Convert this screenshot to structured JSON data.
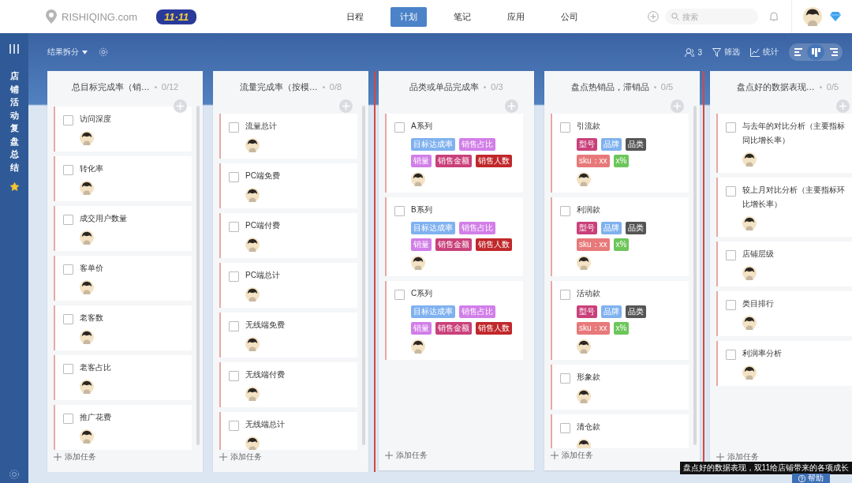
{
  "header": {
    "logo_text": "RISHIQING.com",
    "badge": "11·11",
    "nav": [
      {
        "label": "日程",
        "selected": false
      },
      {
        "label": "计划",
        "selected": true
      },
      {
        "label": "笔记",
        "selected": false
      },
      {
        "label": "应用",
        "selected": false
      },
      {
        "label": "公司",
        "selected": false
      }
    ],
    "search": {
      "placeholder": "搜索"
    }
  },
  "sidebar": {
    "title": "店铺活动复盘总结"
  },
  "toolbar": {
    "view": "结果拆分",
    "members": "3",
    "filter": "筛选",
    "stats": "统计",
    "views": [
      {
        "kind": "left",
        "selected": false
      },
      {
        "kind": "board",
        "selected": true
      },
      {
        "kind": "right",
        "selected": false
      }
    ]
  },
  "columns": [
    {
      "title": "总目标完成率（销…",
      "count": "0/12",
      "highlighted": false,
      "scrollable": true,
      "scrolled_to_end": true,
      "add_label": "添加任务",
      "cards": [
        {
          "title": "访问深度",
          "checked": false
        },
        {
          "title": "转化率",
          "checked": false
        },
        {
          "title": "成交用户数量",
          "checked": false
        },
        {
          "title": "客单价",
          "checked": false
        },
        {
          "title": "老客数",
          "checked": false
        },
        {
          "title": "老客占比",
          "checked": false
        },
        {
          "title": "推广花费",
          "checked": false
        }
      ]
    },
    {
      "title": "流量完成率（按模…",
      "count": "0/8",
      "highlighted": false,
      "scrollable": true,
      "scrolled_to_end": false,
      "add_label": "添加任务",
      "cards": [
        {
          "title": "流量总计",
          "checked": false
        },
        {
          "title": "PC端免费",
          "checked": false
        },
        {
          "title": "PC端付费",
          "checked": false
        },
        {
          "title": "PC端总计",
          "checked": false
        },
        {
          "title": "无线端免费",
          "checked": false
        },
        {
          "title": "无线端付费",
          "checked": false
        },
        {
          "title": "无线端总计",
          "checked": false
        }
      ]
    },
    {
      "title": "品类或单品完成率",
      "count": "0/3",
      "highlighted": true,
      "scrollable": false,
      "scrolled_to_end": false,
      "add_label": "添加任务",
      "cards": [
        {
          "title": "A系列",
          "checked": false,
          "tags": [
            {
              "label": "目标达成率",
              "color": "#7fb1ef"
            },
            {
              "label": "销售占比",
              "color": "#d27ee8"
            },
            {
              "label": "销量",
              "color": "#d27ee8"
            },
            {
              "label": "销售金额",
              "color": "#c9407a"
            },
            {
              "label": "销售人数",
              "color": "#c0282b"
            }
          ]
        },
        {
          "title": "B系列",
          "checked": false,
          "tags": [
            {
              "label": "目标达成率",
              "color": "#7fb1ef"
            },
            {
              "label": "销售占比",
              "color": "#d27ee8"
            },
            {
              "label": "销量",
              "color": "#d27ee8"
            },
            {
              "label": "销售金额",
              "color": "#c9407a"
            },
            {
              "label": "销售人数",
              "color": "#c0282b"
            }
          ]
        },
        {
          "title": "C系列",
          "checked": false,
          "tags": [
            {
              "label": "目标达成率",
              "color": "#7fb1ef"
            },
            {
              "label": "销售占比",
              "color": "#d27ee8"
            },
            {
              "label": "销量",
              "color": "#d27ee8"
            },
            {
              "label": "销售金额",
              "color": "#c9407a"
            },
            {
              "label": "销售人数",
              "color": "#c0282b"
            }
          ]
        }
      ]
    },
    {
      "title": "盘点热销品，滞销品",
      "count": "0/5",
      "highlighted": true,
      "scrollable": true,
      "scrolled_to_end": false,
      "add_label": "添加任务",
      "cards": [
        {
          "title": "引流款",
          "checked": false,
          "tags": [
            {
              "label": "型号",
              "color": "#c9407a"
            },
            {
              "label": "品牌",
              "color": "#7fb1ef"
            },
            {
              "label": "品类",
              "color": "#555555"
            },
            {
              "label": "sku：xx",
              "color": "#e8797a"
            },
            {
              "label": "x%",
              "color": "#6cc65a"
            }
          ]
        },
        {
          "title": "利润款",
          "checked": false,
          "tags": [
            {
              "label": "型号",
              "color": "#c9407a"
            },
            {
              "label": "品牌",
              "color": "#7fb1ef"
            },
            {
              "label": "品类",
              "color": "#555555"
            },
            {
              "label": "sku：xx",
              "color": "#e8797a"
            },
            {
              "label": "x%",
              "color": "#6cc65a"
            }
          ]
        },
        {
          "title": "活动款",
          "checked": false,
          "tags": [
            {
              "label": "型号",
              "color": "#c9407a"
            },
            {
              "label": "品牌",
              "color": "#7fb1ef"
            },
            {
              "label": "品类",
              "color": "#555555"
            },
            {
              "label": "sku：xx",
              "color": "#e8797a"
            },
            {
              "label": "x%",
              "color": "#6cc65a"
            }
          ]
        },
        {
          "title": "形象款",
          "checked": false
        },
        {
          "title": "清仓款",
          "checked": false
        }
      ]
    },
    {
      "title": "盘点好的数据表现…",
      "count": "0/5",
      "highlighted": false,
      "scrolled_to_end": false,
      "add_label": "添加任务",
      "cards": [
        {
          "title": "与去年的对比分析（主要指标同比增长率）",
          "checked": false
        },
        {
          "title": "较上月对比分析（主要指标环比增长率）",
          "checked": false
        },
        {
          "title": "店铺层级",
          "checked": false
        },
        {
          "title": "类目排行",
          "checked": false
        },
        {
          "title": "利润率分析",
          "checked": false
        }
      ]
    }
  ],
  "tooltip": "盘点好的数据表现，双11给店铺带来的各项成长",
  "help": "帮助"
}
